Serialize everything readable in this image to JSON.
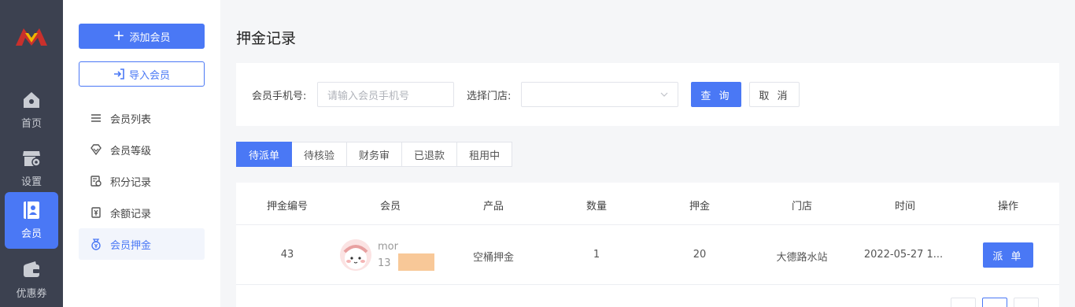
{
  "rail": {
    "items": [
      {
        "label": "首页",
        "icon": "home-icon"
      },
      {
        "label": "设置",
        "icon": "store-settings-icon"
      },
      {
        "label": "会员",
        "icon": "member-card-icon",
        "active": true
      },
      {
        "label": "优惠券",
        "icon": "wallet-icon"
      }
    ]
  },
  "submenu": {
    "add_label": "添加会员",
    "import_label": "导入会员",
    "items": [
      {
        "label": "会员列表",
        "icon": "list-icon"
      },
      {
        "label": "会员等级",
        "icon": "diamond-icon"
      },
      {
        "label": "积分记录",
        "icon": "points-doc-icon"
      },
      {
        "label": "余额记录",
        "icon": "yen-doc-icon"
      },
      {
        "label": "会员押金",
        "icon": "deposit-bag-icon",
        "active": true
      }
    ]
  },
  "page": {
    "title": "押金记录"
  },
  "filters": {
    "phone_label": "会员手机号:",
    "phone_placeholder": "请输入会员手机号",
    "store_label": "选择门店:",
    "store_value": "",
    "query_label": "查 询",
    "cancel_label": "取 消"
  },
  "tabs": [
    {
      "label": "待派单",
      "active": true
    },
    {
      "label": "待核验"
    },
    {
      "label": "财务审"
    },
    {
      "label": "已退款"
    },
    {
      "label": "租用中"
    }
  ],
  "table": {
    "columns": [
      "押金编号",
      "会员",
      "产品",
      "数量",
      "押金",
      "门店",
      "时间",
      "操作"
    ],
    "rows": [
      {
        "id": "43",
        "member_name": "mor",
        "member_phone": "13",
        "product": "空桶押金",
        "quantity": "1",
        "deposit": "20",
        "store": "大德路水站",
        "time": "2022-05-27 1...",
        "action": "派 单"
      }
    ]
  },
  "colors": {
    "primary": "#4a78f5",
    "rail_bg": "#3c4150",
    "page_bg": "#f5f6f8"
  }
}
